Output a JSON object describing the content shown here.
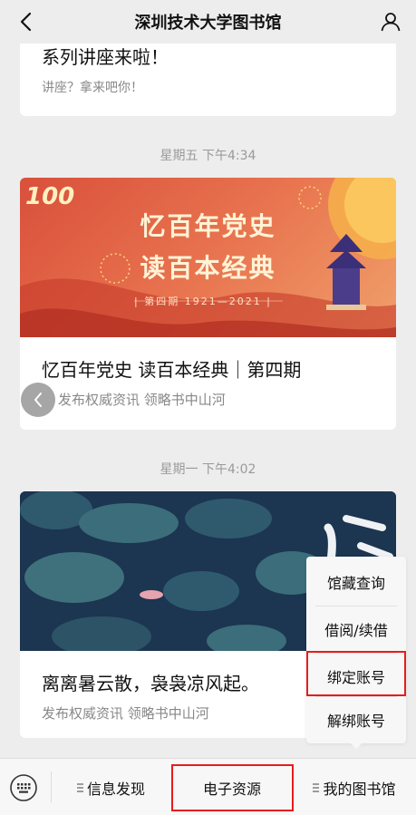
{
  "navbar": {
    "title": "深圳技术大学图书馆",
    "back_icon": "chevron-left-icon",
    "user_icon": "user-profile-icon"
  },
  "messages": [
    {
      "title": "系列讲座来啦！",
      "subtitle": "讲座？拿来吧你！"
    },
    {
      "time": "星期五 下午4:34",
      "banner": {
        "line1": "忆百年党史",
        "line2": "读百本经典",
        "issue": "| 第四期 1921—2021 |"
      },
      "title": "忆百年党史 读百本经典｜第四期",
      "meta": "发布权威资讯 领略书中山河"
    },
    {
      "time": "星期一 下午4:02",
      "title": "离离暑云散，袅袅凉风起。",
      "meta": "发布权威资讯 领略书中山河"
    }
  ],
  "menu_popup": {
    "items": [
      "馆藏查询",
      "借阅/续借",
      "绑定账号",
      "解绑账号"
    ]
  },
  "bottom_bar": {
    "tabs": [
      "信息发现",
      "电子资源",
      "我的图书馆"
    ],
    "keyboard_icon": "keyboard-icon"
  },
  "colors": {
    "highlight": "#e51d1d",
    "banner_red": "#d9503b",
    "banner_navy": "#1f3a52",
    "background": "#ededed"
  }
}
